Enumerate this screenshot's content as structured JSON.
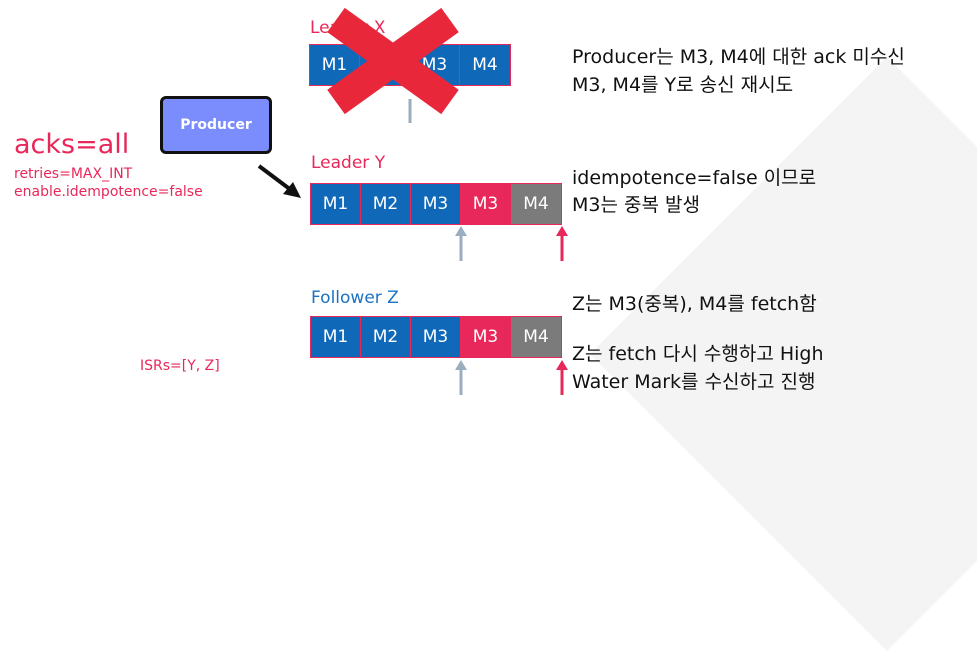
{
  "producer": {
    "label": "Producer"
  },
  "config": {
    "acks": "acks=all",
    "retries": "retries=MAX_INT",
    "idempotence": "enable.idempotence=false",
    "isrs": "ISRs=[Y, Z]"
  },
  "leader_x": {
    "label": "Leader X",
    "cells": [
      "M1",
      "M2",
      "M3",
      "M4"
    ],
    "note_line1": "Producer는 M3, M4에 대한 ack 미수신",
    "note_line2": "M3, M4를 Y로 송신 재시도"
  },
  "leader_y": {
    "label": "Leader Y",
    "cells": [
      "M1",
      "M2",
      "M3",
      "M3",
      "M4"
    ],
    "note_line1": "idempotence=false 이므로",
    "note_line2": "M3는 중복 발생"
  },
  "follower_z": {
    "label": "Follower Z",
    "cells": [
      "M1",
      "M2",
      "M3",
      "M3",
      "M4"
    ],
    "note_fetch": "Z는 M3(중복), M4를 fetch함",
    "note_line1": "Z는 fetch 다시 수행하고 High",
    "note_line2": "Water Mark를 수신하고 진행"
  },
  "colors": {
    "accent_red": "#e8285a",
    "cell_blue": "#1068b8",
    "cell_gray": "#7b7b7b",
    "producer_fill": "#7b8cfc",
    "label_blue": "#1a72c4",
    "marker_gray": "#9aaec0"
  }
}
